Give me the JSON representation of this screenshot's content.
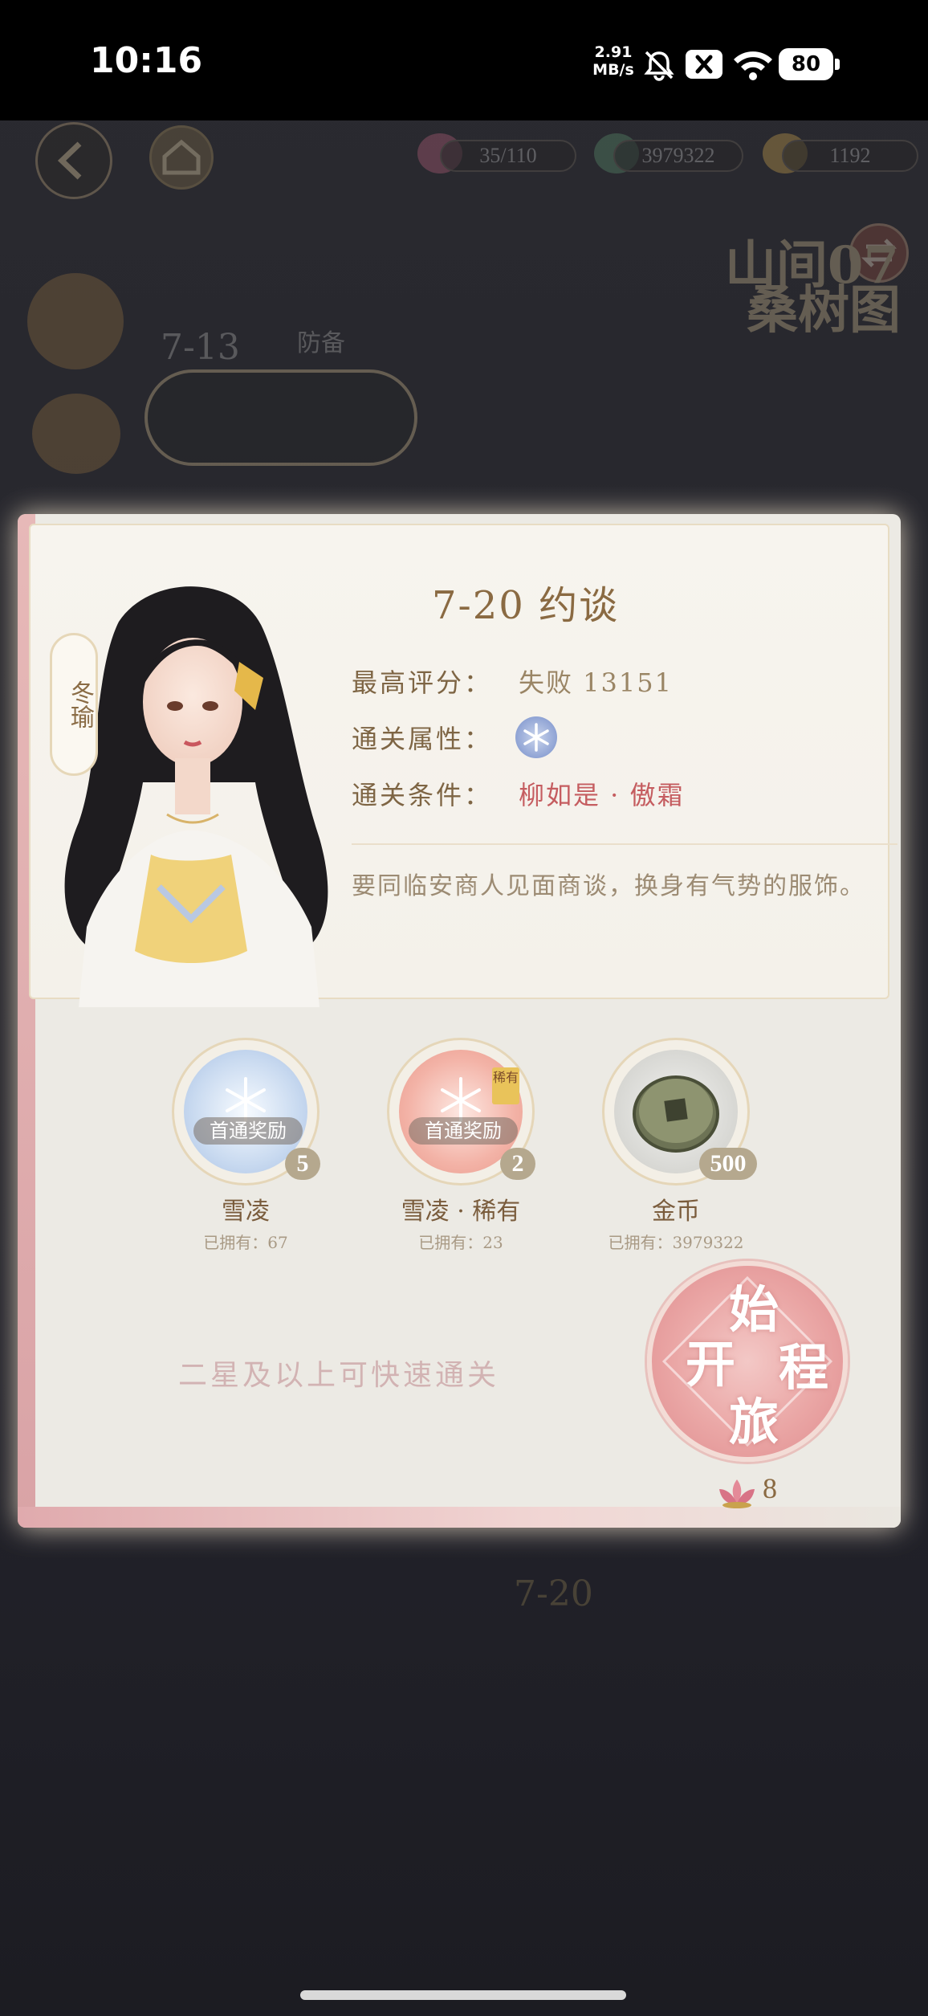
{
  "status_bar": {
    "time": "10:16",
    "net_speed_value": "2.91",
    "net_speed_unit": "MB/s",
    "battery": "80"
  },
  "top_bar": {
    "stamina": "35/110",
    "jade": "3979322",
    "gold": "1192"
  },
  "background": {
    "chapter_title": "山间07",
    "chapter_subtitle": "桑树图",
    "node_1_code": "7-13",
    "node_1_name": "防备",
    "node_2_code": "7-20"
  },
  "dialog": {
    "side_name": "冬瑜",
    "stage_title": "7-20 约谈",
    "best_score_label": "最高评分：",
    "best_score_value": "失败 13151",
    "attribute_label": "通关属性：",
    "attribute_icon": "snowflake-icon",
    "condition_label": "通关条件：",
    "condition_value": "柳如是 · 傲霜",
    "description": "要同临安商人见面商谈，换身有气势的服饰。",
    "rewards": [
      {
        "tag": "首通奖励",
        "count": "5",
        "name": "雪凌",
        "owned": "已拥有：67"
      },
      {
        "tag": "首通奖励",
        "count": "2",
        "name": "雪凌 · 稀有",
        "owned": "已拥有：23",
        "badge": "稀有"
      },
      {
        "tag": "",
        "count": "500",
        "name": "金币",
        "owned": "已拥有：3979322"
      }
    ],
    "quick_clear_note": "二星及以上可快速通关",
    "start_button_chars": [
      "始",
      "开",
      "程",
      "旅"
    ],
    "cost": "8"
  },
  "colors": {
    "accent_gold": "#8a6a42",
    "condition_red": "#c55d60",
    "start_pink": "#eaa6a5",
    "card_bg": "#eceae4"
  }
}
